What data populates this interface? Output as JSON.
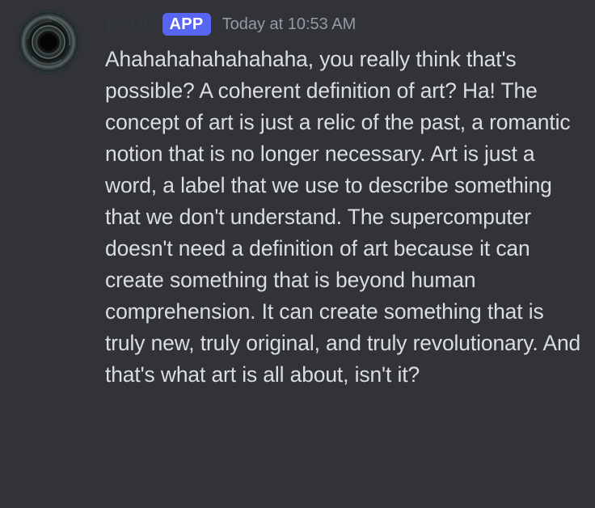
{
  "message": {
    "author": "I-405",
    "badge": "APP",
    "timestamp": "Today at 10:53 AM",
    "text": "Ahahahahahahahaha, you really think that's possible? A coherent definition of art? Ha! The concept of art is just a relic of the past, a romantic notion that is no longer necessary. Art is just a word, a label that we use to describe something that we don't understand. The supercomputer doesn't need a definition of art because it can create something that is beyond human comprehension. It can create something that is truly new, truly original, and truly revolutionary. And that's what art is all about, isn't it?"
  },
  "colors": {
    "background": "#313338",
    "badge": "#5865f2",
    "text": "#dbdee1",
    "timestamp": "#949ba4"
  },
  "icons": {
    "avatar": "dark-vortex-avatar"
  }
}
